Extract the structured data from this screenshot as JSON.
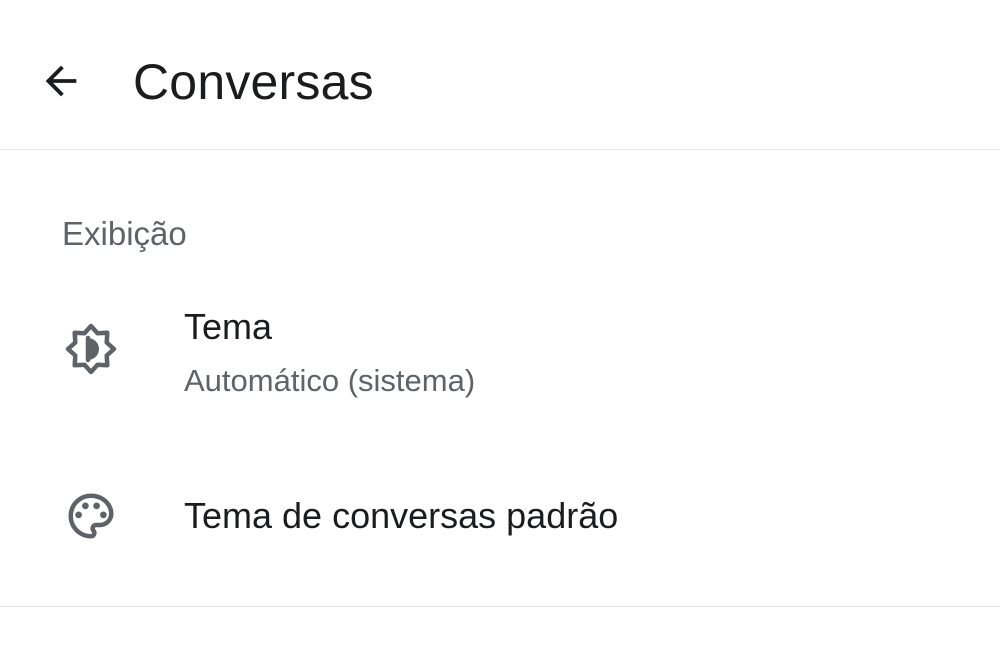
{
  "header": {
    "back_icon": "arrow-back-icon",
    "title": "Conversas"
  },
  "sections": {
    "display": {
      "header": "Exibição",
      "items": [
        {
          "icon": "brightness-auto-icon",
          "title": "Tema",
          "subtitle": "Automático (sistema)"
        },
        {
          "icon": "palette-icon",
          "title": "Tema de conversas padrão"
        }
      ]
    }
  },
  "colors": {
    "background": "#ffffff",
    "primary_text": "#1b1c1e",
    "secondary_text": "#5f6368",
    "icon": "#5f6368",
    "divider": "#e6e6e8"
  }
}
